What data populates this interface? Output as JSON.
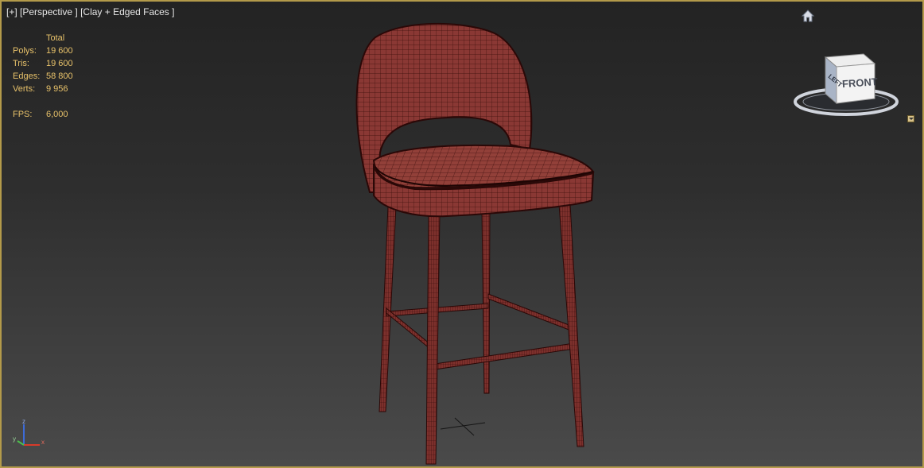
{
  "viewport": {
    "label_parts": [
      "[+]",
      "[Perspective ]",
      "[Clay + Edged Faces ]"
    ]
  },
  "stats": {
    "header": "Total",
    "rows": [
      {
        "label": "Polys:",
        "value": "19 600"
      },
      {
        "label": "Tris:",
        "value": "19 600"
      },
      {
        "label": "Edges:",
        "value": "58 800"
      },
      {
        "label": "Verts:",
        "value": "9 956"
      }
    ],
    "fps_label": "FPS:",
    "fps_value": "6,000"
  },
  "viewcube": {
    "face_front": "FRONT",
    "face_left": "LEFT"
  },
  "axis": {
    "x": "x",
    "y": "y",
    "z": "z"
  },
  "colors": {
    "viewport_border": "#b39a4a",
    "stats_text": "#e8c26a",
    "model_fill": "#8e3a36",
    "model_wire": "#3a0d0b"
  },
  "icons": {
    "home": "home-icon",
    "viewcube_menu": "chevron-down-icon"
  }
}
